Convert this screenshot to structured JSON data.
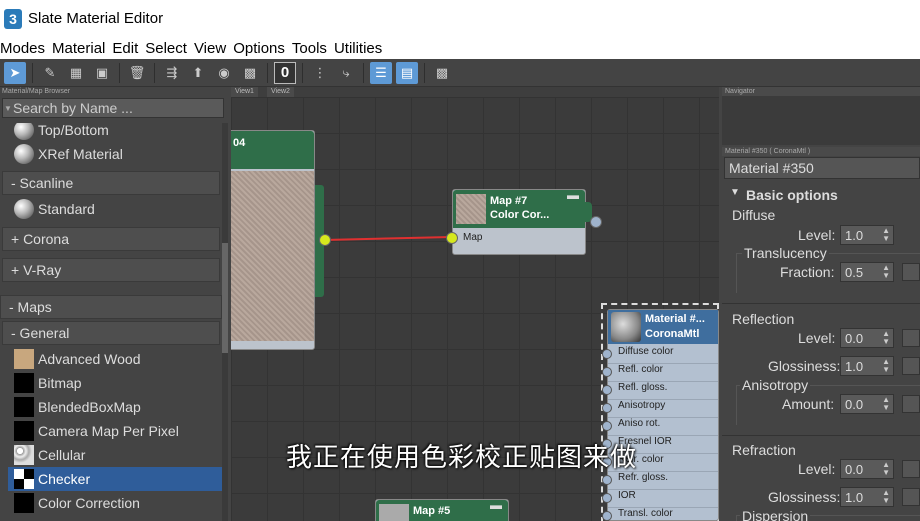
{
  "window": {
    "title": "Slate Material Editor",
    "app_icon_text": "3"
  },
  "menu": [
    "Modes",
    "Material",
    "Edit",
    "Select",
    "View",
    "Options",
    "Tools",
    "Utilities"
  ],
  "toolbar": {
    "number_box": "0"
  },
  "browser": {
    "header": "Material/Map Browser",
    "search_placeholder": "Search by Name ...",
    "items": [
      {
        "kind": "item",
        "label": "Top/Bottom",
        "swatch": "sphere"
      },
      {
        "kind": "item",
        "label": "XRef Material",
        "swatch": "sphere"
      },
      {
        "kind": "category",
        "label": "- Scanline"
      },
      {
        "kind": "item",
        "label": "Standard",
        "swatch": "sphere"
      },
      {
        "kind": "category",
        "label": "+ Corona"
      },
      {
        "kind": "category",
        "label": "+ V-Ray"
      },
      {
        "kind": "category",
        "label": "- Maps"
      },
      {
        "kind": "category",
        "label": "- General"
      },
      {
        "kind": "item",
        "label": "Advanced Wood",
        "swatch": "wood"
      },
      {
        "kind": "item",
        "label": "Bitmap",
        "swatch": "black"
      },
      {
        "kind": "item",
        "label": "BlendedBoxMap",
        "swatch": "black"
      },
      {
        "kind": "item",
        "label": "Camera Map Per Pixel",
        "swatch": "black"
      },
      {
        "kind": "item",
        "label": "Cellular",
        "swatch": "cellular"
      },
      {
        "kind": "item",
        "label": "Checker",
        "swatch": "checker",
        "selected": true
      },
      {
        "kind": "item",
        "label": "Color Correction",
        "swatch": "black"
      }
    ]
  },
  "view": {
    "tabs": [
      "View1",
      "View2"
    ],
    "nodes": {
      "left": {
        "title": "04"
      },
      "map7": {
        "title": "Map #7",
        "subtitle": "Color Cor...",
        "slot": "Map"
      },
      "material": {
        "title": "Material #...",
        "subtitle": "CoronaMtl",
        "slots": [
          "Diffuse color",
          "Refl. color",
          "Refl. gloss.",
          "Anisotropy",
          "Aniso rot.",
          "Fresnel IOR",
          "Refr. color",
          "Refr. gloss.",
          "IOR",
          "Transl. color"
        ]
      },
      "map5": {
        "title": "Map #5"
      }
    },
    "wire_color": "#e03030",
    "socket_color": "#d6e81e"
  },
  "navigator": {
    "header": "Navigator"
  },
  "props": {
    "header": "Material #350  ( CoronaMtl )",
    "material_name": "Material #350",
    "rollout": "Basic options",
    "diffuse_label": "Diffuse",
    "level_label": "Level:",
    "diffuse_level": "1.0",
    "translucency_label": "Translucency",
    "fraction_label": "Fraction:",
    "fraction": "0.5",
    "reflection_label": "Reflection",
    "reflection_level": "0.0",
    "glossiness_label": "Glossiness:",
    "reflection_gloss": "1.0",
    "anisotropy_label": "Anisotropy",
    "amount_label": "Amount:",
    "aniso_amount": "0.0",
    "refraction_label": "Refraction",
    "refraction_level": "0.0",
    "refraction_gloss": "1.0",
    "dispersion_label": "Dispersion"
  },
  "subtitle": "我正在使用色彩校正贴图来做"
}
